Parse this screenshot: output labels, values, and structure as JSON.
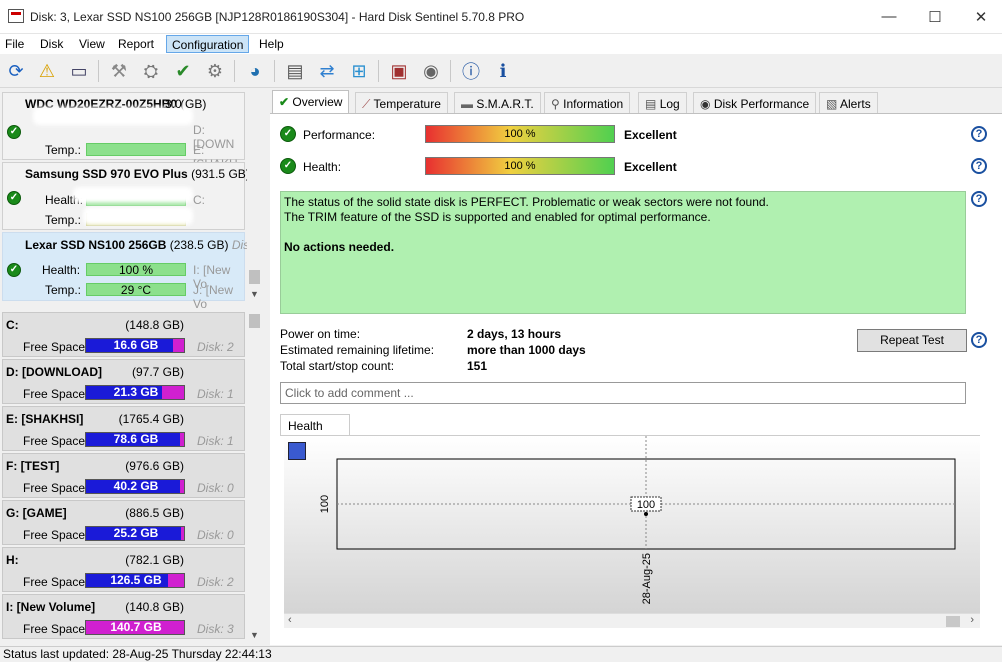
{
  "window": {
    "title": "Disk: 3, Lexar SSD NS100 256GB [NJP128R0186190S304]  -  Hard Disk Sentinel 5.70.8 PRO",
    "minimize": "—",
    "maximize": "☐",
    "close": "✕"
  },
  "menu": [
    "File",
    "Disk",
    "View",
    "Report",
    "Configuration",
    "Help"
  ],
  "toolbar": {
    "icons": [
      "refresh-icon",
      "alert-icon",
      "drive-icon",
      "wrench-gray-icon",
      "test-icon",
      "test-check-icon",
      "wrench-icon",
      "globe-icon",
      "document-icon",
      "sync-icon",
      "network-icon",
      "monitor-icon",
      "speaker-icon",
      "help-icon",
      "info-icon"
    ]
  },
  "disks": [
    {
      "name": "WDC WD20EZRZ-00Z5HB0",
      "size_partial": "(",
      "size": "3.0 GB)",
      "vol1": "D: [DOWN",
      "temp_label": "Temp.:",
      "vol2": "E: [SHAKH"
    },
    {
      "name": "Samsung SSD 970 EVO Plus",
      "size": "(931.5 GB)",
      "health_label": "Health:",
      "vol1": "C:",
      "temp_label": "Temp.:"
    },
    {
      "name": "Lexar SSD NS100 256GB",
      "size": "(238.5 GB)",
      "disk_label": "Disk",
      "health_label": "Health:",
      "health": "100 %",
      "vol1": "I: [New Vo",
      "temp_label": "Temp.:",
      "temp": "29 °C",
      "vol2": "J: [New Vo"
    }
  ],
  "volumes": [
    {
      "name": "C:",
      "size": "(148.8 GB)",
      "free_label": "Free Space",
      "free": "16.6 GB",
      "free_fraction": 0.89,
      "disk": "Disk: 2"
    },
    {
      "name": "D: [DOWNLOAD]",
      "size": "(97.7 GB)",
      "free_label": "Free Space",
      "free": "21.3 GB",
      "free_fraction": 0.78,
      "disk": "Disk: 1"
    },
    {
      "name": "E: [SHAKHSI]",
      "size": "(1765.4 GB)",
      "free_label": "Free Space",
      "free": "78.6 GB",
      "free_fraction": 0.96,
      "disk": "Disk: 1"
    },
    {
      "name": "F: [TEST]",
      "size": "(976.6 GB)",
      "free_label": "Free Space",
      "free": "40.2 GB",
      "free_fraction": 0.96,
      "disk": "Disk: 0"
    },
    {
      "name": "G: [GAME]",
      "size": "(886.5 GB)",
      "free_label": "Free Space",
      "free": "25.2 GB",
      "free_fraction": 0.97,
      "disk": "Disk: 0"
    },
    {
      "name": "H:",
      "size": "(782.1 GB)",
      "free_label": "Free Space",
      "free": "126.5 GB",
      "free_fraction": 0.84,
      "disk": "Disk: 2"
    },
    {
      "name": "I: [New Volume]",
      "size": "(140.8 GB)",
      "free_label": "Free Space",
      "free": "140.7 GB",
      "free_fraction": 0.0,
      "disk": "Disk: 3"
    }
  ],
  "tabs": [
    "Overview",
    "Temperature",
    "S.M.A.R.T.",
    "Information",
    "Log",
    "Disk Performance",
    "Alerts"
  ],
  "overview": {
    "performance_label": "Performance:",
    "performance_value": "100 %",
    "performance_rating": "Excellent",
    "health_label": "Health:",
    "health_value": "100 %",
    "health_rating": "Excellent",
    "status_line1": "The status of the solid state disk is PERFECT. Problematic or weak sectors were not found.",
    "status_line2": "The TRIM feature of the SSD is supported and enabled for optimal performance.",
    "status_line3": "No actions needed.",
    "power_on_label": "Power on time:",
    "power_on_value": "2 days, 13 hours",
    "lifetime_label": "Estimated remaining lifetime:",
    "lifetime_value": "more than 1000 days",
    "startstop_label": "Total start/stop count:",
    "startstop_value": "151",
    "repeat_button": "Repeat Test",
    "comment_placeholder": "Click to add comment ...",
    "health_tab": "Health (%)"
  },
  "chart_data": {
    "type": "line",
    "x": [
      "28-Aug-25"
    ],
    "series": [
      {
        "values": [
          100
        ]
      }
    ],
    "y_tick": "100",
    "data_label": "100"
  },
  "statusbar": "Status last updated: 28-Aug-25 Thursday 22:44:13",
  "colors": {
    "healthy": "#8ce08c",
    "free_space": "#1a1ad8",
    "used_space": "#d020d0",
    "status_box": "#b0f0b0"
  }
}
